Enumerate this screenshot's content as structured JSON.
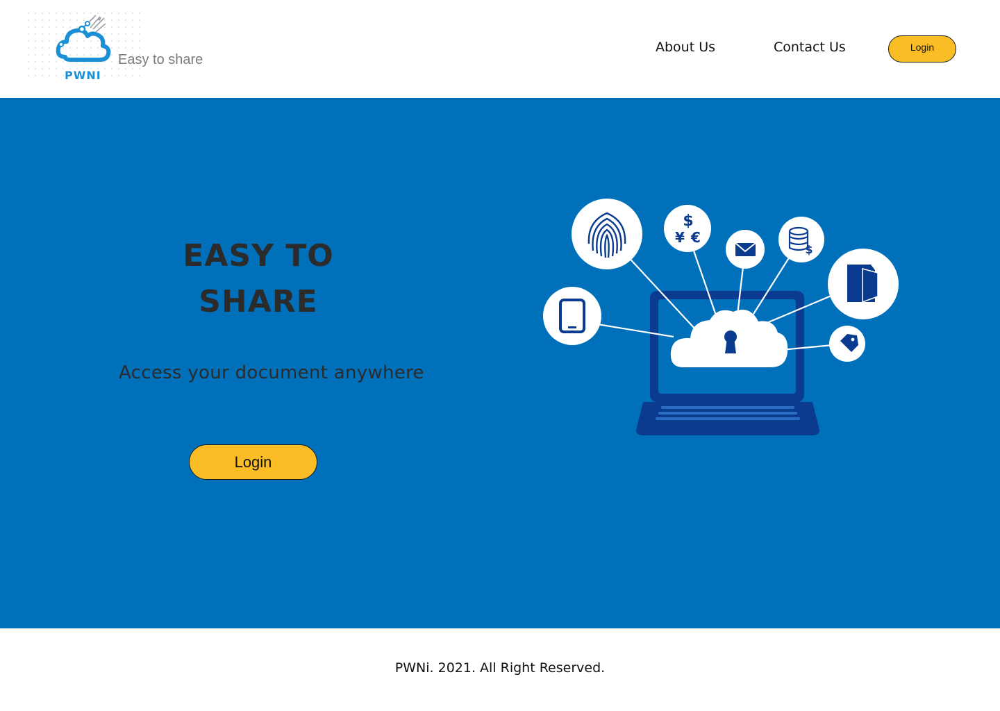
{
  "brand": {
    "name": "PWNI",
    "tagline": "Easy to share",
    "color": "#1a8fd6"
  },
  "nav": {
    "about_label": "About Us",
    "contact_label": "Contact Us",
    "login_label": "Login"
  },
  "hero": {
    "title_line1": "EASY TO",
    "title_line2": "SHARE",
    "subtitle": "Access your document anywhere",
    "login_label": "Login",
    "background_color": "#0070ba",
    "button_color": "#fbbd25"
  },
  "illustration": {
    "icons": [
      "fingerprint-icon",
      "currency-icon",
      "mail-icon",
      "coins-icon",
      "folder-icon",
      "tablet-icon",
      "tag-icon",
      "cloud-lock-icon",
      "laptop-icon"
    ]
  },
  "footer": {
    "copyright": "PWNi. 2021. All Right Reserved."
  }
}
